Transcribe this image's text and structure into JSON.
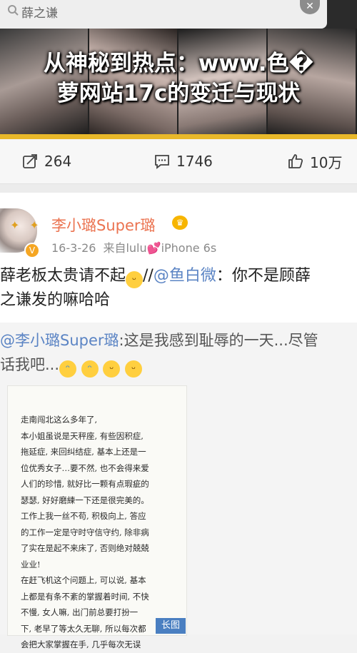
{
  "search": {
    "query": "薛之谦",
    "clear_icon": "close-icon"
  },
  "banner": {
    "title_line1": "从神秘到热点：www.色�",
    "title_line2": "萝网站17c的变迁与现状",
    "accent_color": "#e8b82a"
  },
  "actions": {
    "repost_count": "264",
    "comment_count": "1746",
    "like_count": "10万"
  },
  "post": {
    "user_name": "李小璐Super璐",
    "date": "16-3-26",
    "source_prefix": "来自lulu",
    "source_suffix": "iPhone 6s",
    "text_line1_a": "薛老板太贵请不起",
    "text_line1_b": "//",
    "text_line1_mention": "@鱼白微",
    "text_line1_c": "：你不是顾薛",
    "text_line2": "之谦发的嘛哈哈",
    "name_color": "#eb7350"
  },
  "retweet": {
    "mention": "@李小璐Super璐",
    "text_line1": ":这是我感到耻辱的一天...尽管",
    "text_line2": "话我吧...",
    "letter_lines": [
      "走南闯北这么多年了,",
      "本小姐虽说是天秤座, 有些因积症,",
      "拖延症, 来回纠结症, 基本上还是一",
      "位优秀女子…要不然, 也不会得来爱",
      "人们的珍惜, 就好比一颗有点瑕疵的",
      "瑟瑟, 好好磨練一下还是很完美的。",
      "工作上我一丝不苟, 积极向上, 答应",
      "的工作一定是守时守信守约, 除非病",
      "了实在是起不来床了, 否则绝对兢兢",
      "业业!",
      "在赶飞机这个问题上, 可以说, 基本",
      "上都是有条不紊的掌握着时间, 不快",
      "不慢, 女人嘛, 出门前总要打扮一",
      "下, 老早了等太久无聊, 所以每次都",
      "会把大家掌握在手, 几乎每次无误"
    ],
    "long_image_badge": "长图"
  }
}
